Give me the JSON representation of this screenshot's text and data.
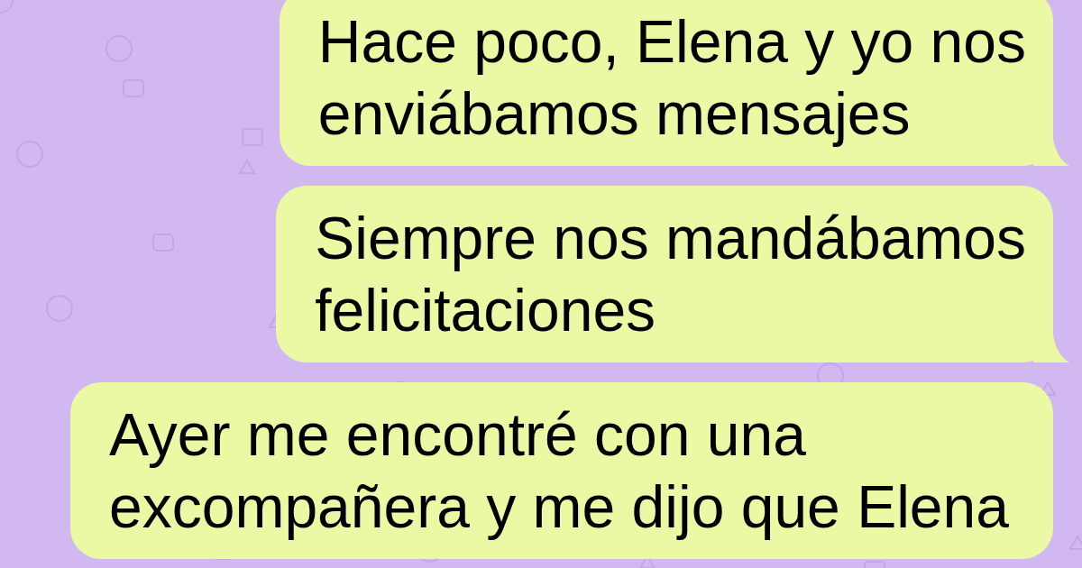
{
  "messages": [
    {
      "kind": "outgoing",
      "tail": true,
      "lines": [
        "Hace poco, Elena y yo nos",
        "enviábamos mensajes"
      ]
    },
    {
      "kind": "outgoing",
      "tail": true,
      "lines": [
        "Siempre nos mandábamos",
        "felicitaciones"
      ]
    },
    {
      "kind": "outgoing",
      "tail": false,
      "lines": [
        "Ayer me encontré con una",
        "excompañera y me dijo que Elena"
      ]
    }
  ]
}
